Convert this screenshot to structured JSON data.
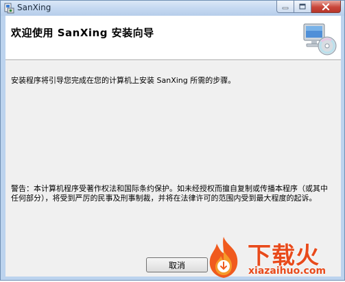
{
  "window": {
    "title": "SanXing",
    "icon": "installer-app-icon"
  },
  "caption_buttons": {
    "minimize_icon": "minimize-icon",
    "maximize_icon": "maximize-icon",
    "close_icon": "close-icon"
  },
  "header": {
    "title": "欢迎使用 SanXing 安装向导",
    "graphic": "computer-cd-icon"
  },
  "content": {
    "intro": "安装程序将引导您完成在您的计算机上安装 SanXing 所需的步骤。",
    "warning": "警告：本计算机程序受著作权法和国际条约保护。如未经授权而擅自复制或传播本程序（或其中任何部分），将受到严厉的民事及刑事制裁，并将在法律许可的范围内受到最大程度的起诉。"
  },
  "buttons": {
    "cancel": "取消"
  },
  "watermark": {
    "title": "下载火",
    "subtitle": "xiazaihuo.com",
    "color": "#e84a1b"
  }
}
